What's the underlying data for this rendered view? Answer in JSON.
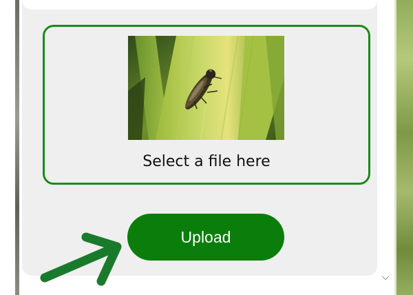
{
  "dropzone": {
    "label": "Select a file here",
    "image_description_icon": "leafhopper-on-leaf-icon"
  },
  "upload": {
    "label": "Upload"
  },
  "scroll": {
    "down_icon": "chevron-down-icon"
  },
  "colors": {
    "brand_green": "#0b7d0b",
    "dropzone_border": "#1a8a1a",
    "panel_background": "#efefef",
    "arrow_green": "#1a7a2c"
  }
}
